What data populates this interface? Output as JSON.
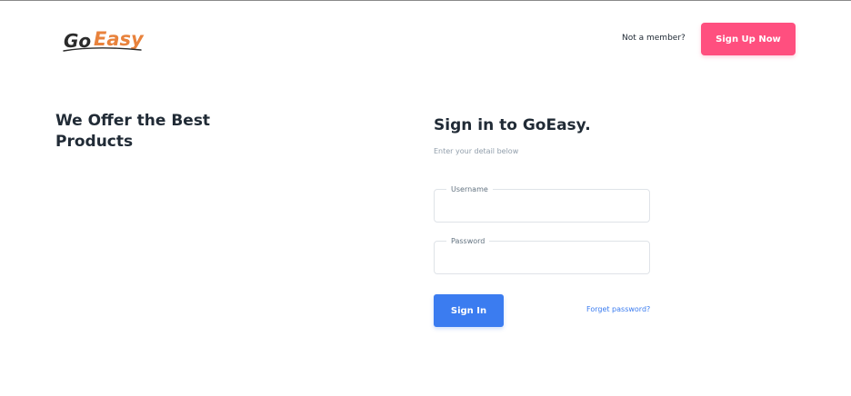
{
  "brand": {
    "logo_part1": "Go",
    "logo_part2": "Easy",
    "colors": {
      "dark": "#2b2b2b",
      "orange": "#e8823c"
    }
  },
  "header": {
    "prompt": "Not a member?",
    "signup_label": "Sign Up Now",
    "signup_color": "#ff4f7f"
  },
  "hero": {
    "title": "We Offer the Best Products"
  },
  "signin": {
    "title": "Sign in to GoEasy.",
    "subtitle": "Enter your detail below",
    "username_label": "Username",
    "username_value": "",
    "password_label": "Password",
    "password_value": "",
    "submit_label": "Sign In",
    "submit_color": "#3b7cf0",
    "forgot_label": "Forget password?"
  }
}
